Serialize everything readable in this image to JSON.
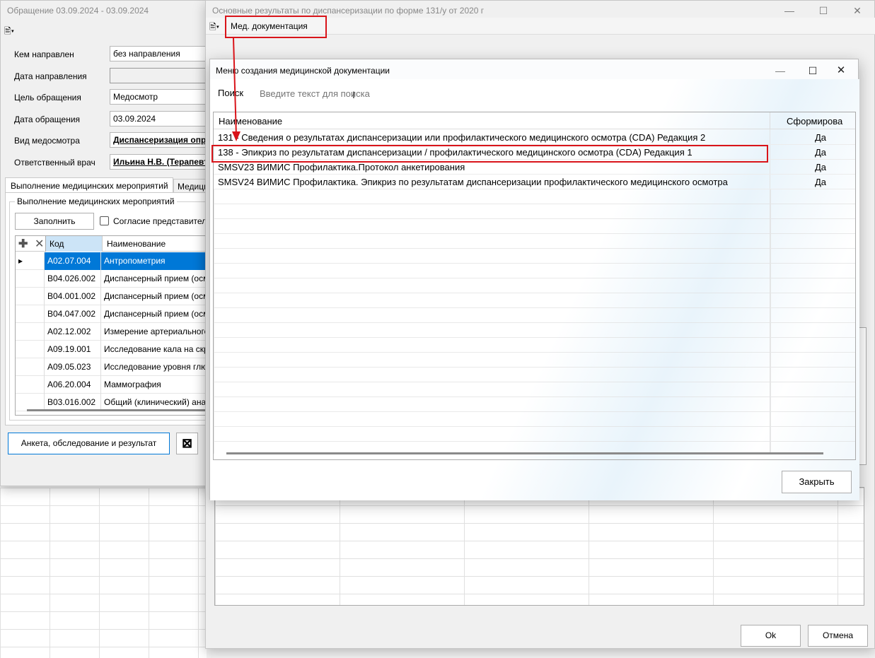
{
  "left_window": {
    "title": "Обращение 03.09.2024 - 03.09.2024",
    "fields": [
      {
        "label": "Кем направлен",
        "value": "без направления"
      },
      {
        "label": "Дата направления",
        "value": ""
      },
      {
        "label": "Цель обращения",
        "value": "Медосмотр"
      },
      {
        "label": "Дата обращения",
        "value": "03.09.2024"
      },
      {
        "label": "Вид медосмотра",
        "value": "Диспансеризация опре"
      },
      {
        "label": "Ответственный врач",
        "value": "Ильина Н.В. (Терапевт у"
      }
    ],
    "tabs": [
      "Выполнение медицинских мероприятий",
      "Медици"
    ],
    "group_title": "Выполнение медицинских мероприятий",
    "fill_button": "Заполнить",
    "consent_label": "Согласие представителя",
    "grid_headers": {
      "code": "Код",
      "name": "Наименование"
    },
    "rows": [
      {
        "code": "A02.07.004",
        "name": "Антропометрия"
      },
      {
        "code": "B04.026.002",
        "name": "Диспансерный прием (осм"
      },
      {
        "code": "B04.001.002",
        "name": "Диспансерный прием (осм"
      },
      {
        "code": "B04.047.002",
        "name": "Диспансерный прием (осм"
      },
      {
        "code": "A02.12.002",
        "name": "Измерение артериального"
      },
      {
        "code": "A09.19.001",
        "name": "Исследование кала на скр"
      },
      {
        "code": "A09.05.023",
        "name": "Исследование уровня глю"
      },
      {
        "code": "A06.20.004",
        "name": "Маммография"
      },
      {
        "code": "B03.016.002",
        "name": "Общий (клинический) ана"
      }
    ],
    "survey_button": "Анкета, обследование и результат"
  },
  "middle_window": {
    "title": "Основные результаты по диспансеризации по форме 131/у от 2020 г",
    "toolbar_button": "Мед. документация",
    "ok_button": "Ok",
    "cancel_button": "Отмена"
  },
  "dialog": {
    "title": "Меню создания медицинской документации",
    "search_label": "Поиск",
    "search_placeholder": "Введите текст для поиска",
    "headers": {
      "name": "Наименование",
      "formed": "Сформирова"
    },
    "rows": [
      {
        "name": "131 - Сведения о результатах диспансеризации или профилактического медицинского осмотра (CDA) Редакция 2",
        "formed": "Да"
      },
      {
        "name": "138 - Эпикриз по результатам диспансеризации / профилактического медицинского осмотра (CDA) Редакция 1",
        "formed": "Да"
      },
      {
        "name": "SMSV23 ВИМИС Профилактика.Протокол анкетирования",
        "formed": "Да"
      },
      {
        "name": "SMSV24 ВИМИС Профилактика. Эпикриз по результатам диспансеризации профилактического медицинского осмотра",
        "formed": "Да"
      }
    ],
    "close_button": "Закрыть"
  },
  "colors": {
    "annotation": "#d9141a",
    "selection": "#0078d7"
  }
}
